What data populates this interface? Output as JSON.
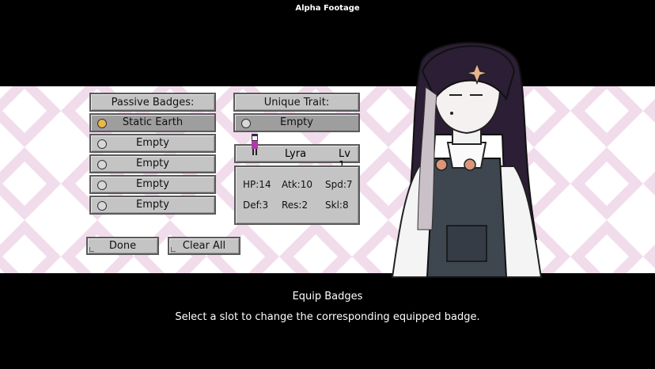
{
  "window": {
    "title": "Alpha Footage"
  },
  "passive": {
    "header": "Passive Badges:",
    "slots": [
      "Static Earth",
      "Empty",
      "Empty",
      "Empty",
      "Empty"
    ]
  },
  "unique": {
    "header": "Unique Trait:",
    "slot": "Empty"
  },
  "character": {
    "name": "Lyra",
    "level": "Lv 1",
    "stats": {
      "hp": "HP:14",
      "atk": "Atk:10",
      "spd": "Spd:7",
      "def": "Def:3",
      "res": "Res:2",
      "skl": "Skl:8"
    }
  },
  "buttons": {
    "done": "Done",
    "clear_all": "Clear All"
  },
  "footer": {
    "title": "Equip Badges",
    "description": "Select a slot to change the corresponding equipped badge."
  },
  "colors": {
    "background": "#000000",
    "band": "#ffffff",
    "diamond": "#f1dcec",
    "panel": "#c4c4c4",
    "panel_selected": "#9e9e9e"
  },
  "icons": {
    "badge": "static-earth-badge-icon",
    "empty": "empty-slot-icon"
  }
}
